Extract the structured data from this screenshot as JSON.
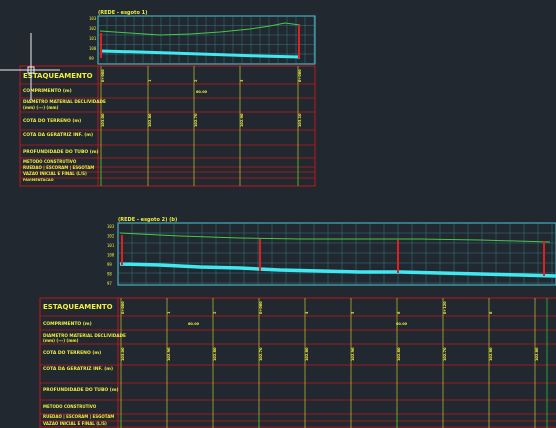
{
  "colors": {
    "background": "#212830",
    "frame_red": "#c01818",
    "grid_cyan": "#4ec8d8",
    "label_yellow": "#f0ee40",
    "terrain_green": "#48c848",
    "pipe_cyan": "#40e8f0",
    "crosshair_white": "#f0f0f0",
    "vertical_red": "#e02020",
    "divider_green": "#30c030"
  },
  "icons": {
    "crosshair": "crosshair-icon"
  },
  "profile_top": {
    "title": "(REDE - esgoto 1)",
    "y_ticks": [
      "103",
      "102",
      "101",
      "100",
      "99"
    ],
    "table_labels": [
      "ESTAQUEAMENTO",
      "COMPRIMENTO (m)",
      "DIAMETRO MATERIAL DECLIVIDADE",
      "(mm)      (---)       (mm)",
      "COTA DO TERRENO (m)",
      "COTA DA GERATRIZ INF. (m)",
      "PROFUNDIDADE DO TUBO (m)",
      "METODO CONSTRUTIVO",
      "RUEDAO | ESCORAM | ESGOTAM",
      "VAZAO INICIAL E FINAL (L/S)",
      "PAVIMENTACAO"
    ],
    "stations": [
      "0+000",
      "1",
      "2",
      "3",
      "0+060"
    ],
    "length_value": "60.00",
    "cota_values": [
      "103.00",
      "102.80",
      "102.70",
      "102.90",
      "103.10"
    ]
  },
  "profile_bottom": {
    "title": "(REDE - esgoto 2) (b)",
    "y_ticks": [
      "103",
      "102",
      "101",
      "100",
      "99",
      "98",
      "97"
    ],
    "table_labels": [
      "ESTAQUEAMENTO",
      "COMPRIMENTO (m)",
      "DIAMETRO MATERIAL DECLIVIDADE",
      "(mm)      (---)       (mm)",
      "COTA DO TERRENO (m)",
      "COTA DA GERATRIZ INF. (m)",
      "PROFUNDIDADE DO TUBO (m)",
      "METODO CONSTRUTIVO",
      "RUEDAO | ESCORAM | ESGOTAM",
      "VAZAO INICIAL E FINAL (L/S)",
      "PAVIMENTACAO"
    ],
    "stations": [
      "0+000",
      "1",
      "2",
      "0+060",
      "4",
      "5",
      "6",
      "0+120",
      "8"
    ],
    "length_values": [
      "60.00",
      "60.00"
    ],
    "cota_values": [
      "103.00",
      "102.90",
      "102.80",
      "102.70",
      "102.80",
      "102.90",
      "102.80",
      "102.70",
      "102.60",
      "102.60"
    ]
  }
}
